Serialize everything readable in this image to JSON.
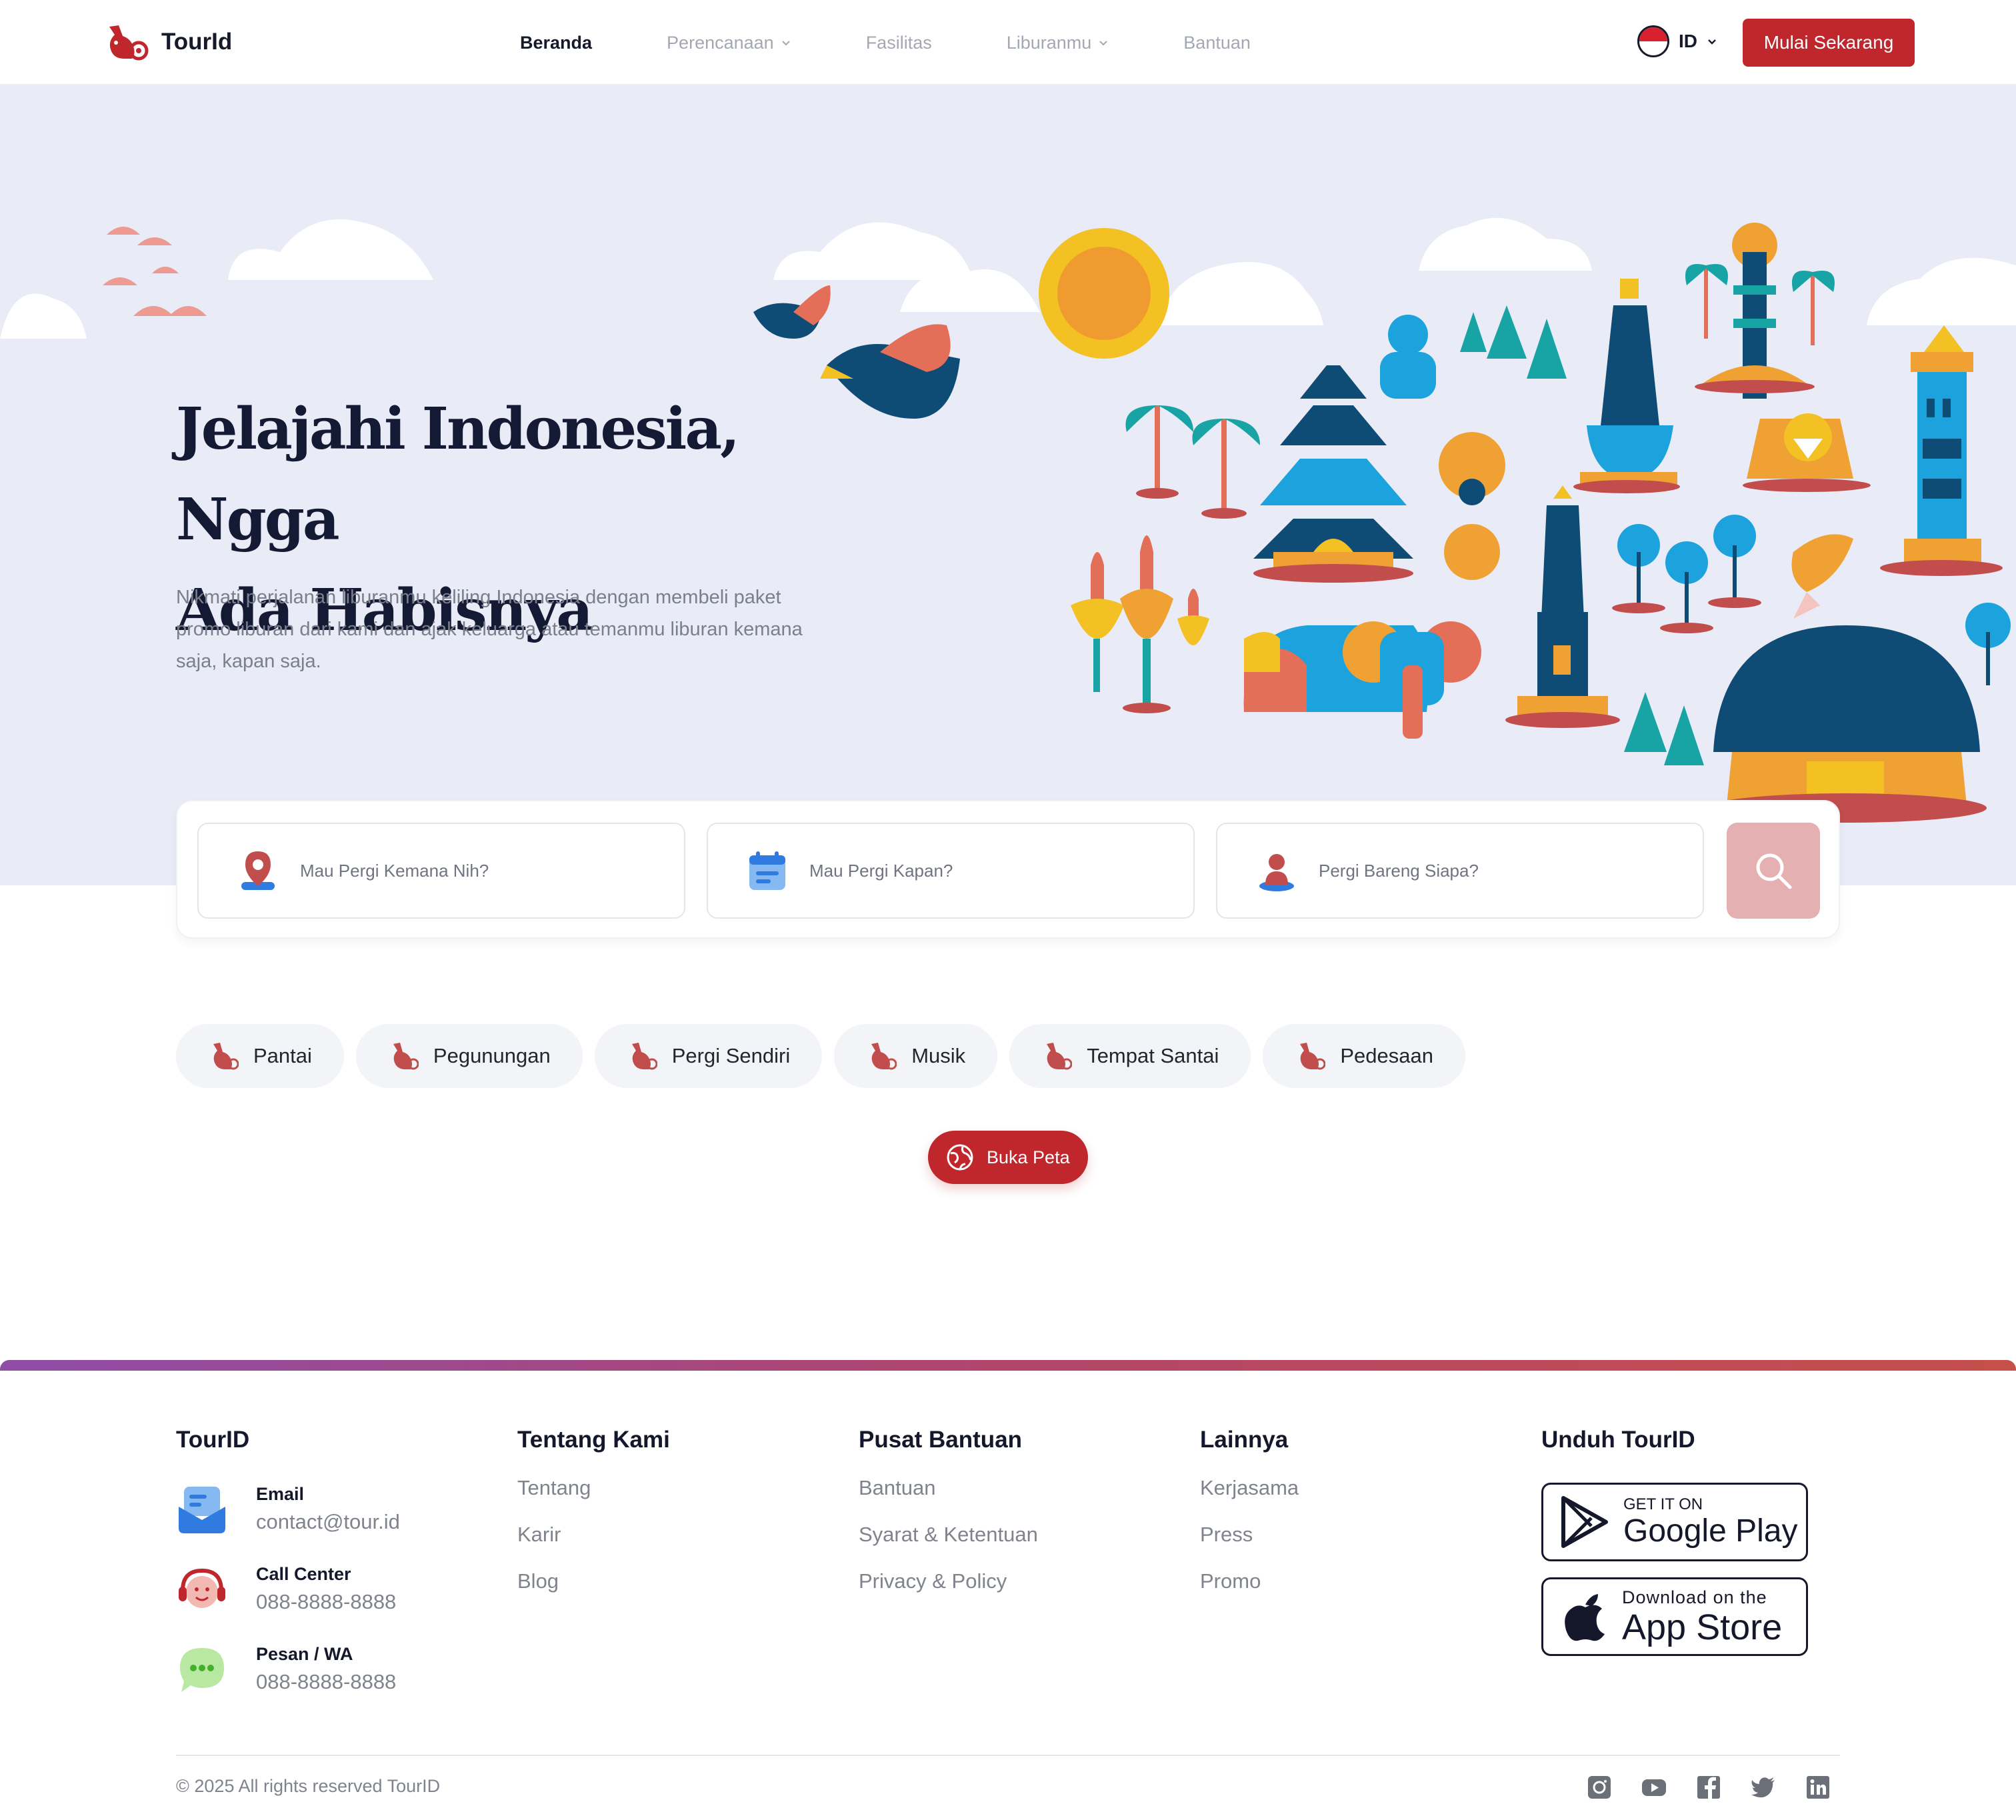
{
  "brand": {
    "name": "TourId",
    "accent": "#c0272d"
  },
  "nav": {
    "items": [
      {
        "label": "Beranda",
        "active": true,
        "dropdown": false
      },
      {
        "label": "Perencanaan",
        "active": false,
        "dropdown": true
      },
      {
        "label": "Fasilitas",
        "active": false,
        "dropdown": false
      },
      {
        "label": "Liburanmu",
        "active": false,
        "dropdown": true
      },
      {
        "label": "Bantuan",
        "active": false,
        "dropdown": false
      }
    ],
    "language": "ID",
    "cta_label": "Mulai Sekarang"
  },
  "hero": {
    "title_line1": "Jelajahi Indonesia, Ngga",
    "title_line2": "Ada Habisnya",
    "description": "Nikmati perjalanan liburanmu keliling Indonesia dengan membeli paket promo liburan dari kami dan ajak keluarga atau temanmu liburan kemana saja, kapan saja."
  },
  "search": {
    "destination_placeholder": "Mau Pergi Kemana Nih?",
    "date_placeholder": "Mau Pergi Kapan?",
    "companion_placeholder": "Pergi Bareng Siapa?",
    "button_icon": "search-icon"
  },
  "categories": [
    "Pantai",
    "Pegunungan",
    "Pergi Sendiri",
    "Musik",
    "Tempat Santai",
    "Pedesaan"
  ],
  "map_button_label": "Buka Peta",
  "footer": {
    "brand_heading": "TourID",
    "contacts": [
      {
        "label": "Email",
        "value": "contact@tour.id",
        "icon": "email-icon"
      },
      {
        "label": "Call Center",
        "value": "088-8888-8888",
        "icon": "call-center-icon"
      },
      {
        "label": "Pesan / WA",
        "value": "088-8888-8888",
        "icon": "chat-icon"
      }
    ],
    "columns": [
      {
        "heading": "Tentang Kami",
        "links": [
          "Tentang",
          "Karir",
          "Blog"
        ]
      },
      {
        "heading": "Pusat Bantuan",
        "links": [
          "Bantuan",
          "Syarat & Ketentuan",
          "Privacy & Policy"
        ]
      },
      {
        "heading": "Lainnya",
        "links": [
          "Kerjasama",
          "Press",
          "Promo"
        ]
      }
    ],
    "download_heading": "Unduh TourID",
    "google_play": {
      "small": "GET IT ON",
      "big": "Google Play"
    },
    "app_store": {
      "small": "Download on the",
      "big": "App Store"
    },
    "copyright": "© 2025 All rights reserved TourID",
    "socials": [
      "instagram-icon",
      "youtube-icon",
      "facebook-icon",
      "twitter-icon",
      "linkedin-icon"
    ]
  }
}
